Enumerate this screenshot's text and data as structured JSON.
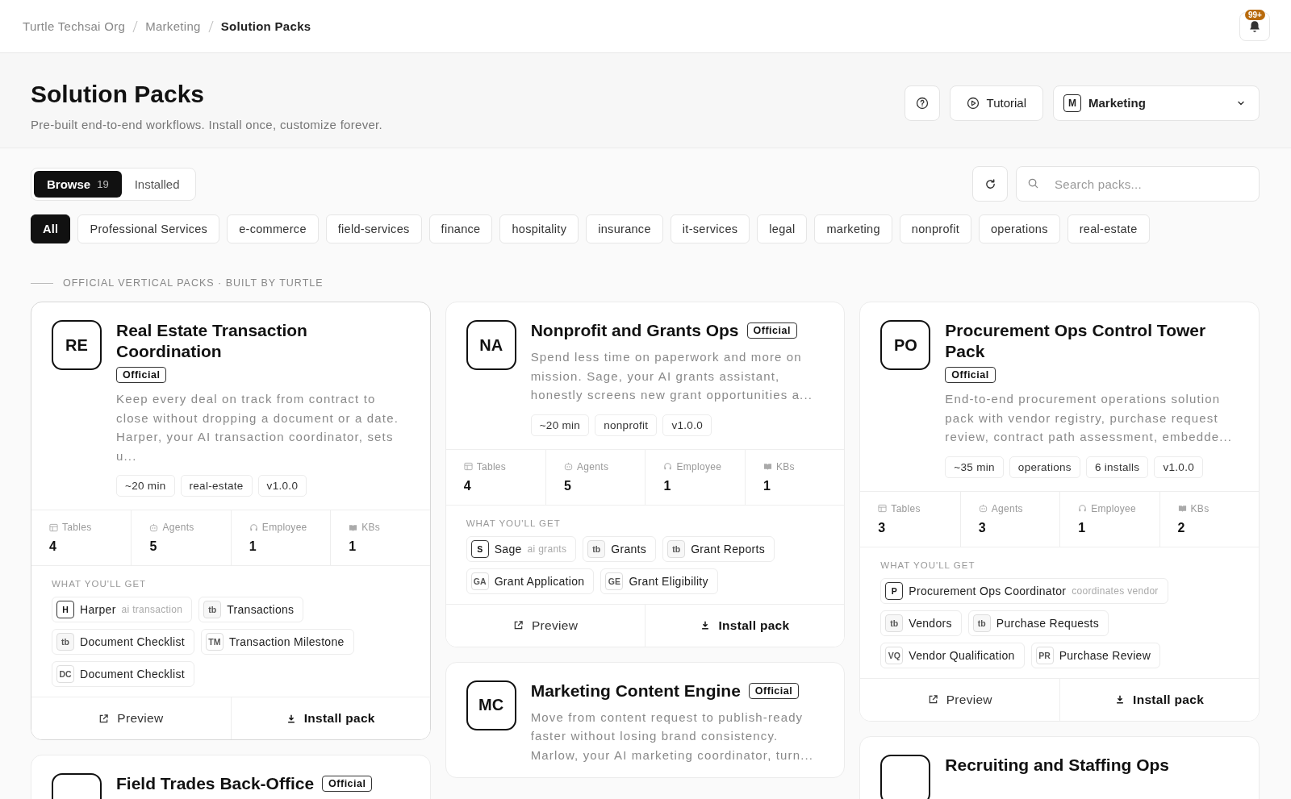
{
  "breadcrumb": [
    {
      "label": "Turtle Techsai Org",
      "current": false
    },
    {
      "label": "Marketing",
      "current": false
    },
    {
      "label": "Solution Packs",
      "current": true
    }
  ],
  "notifications": {
    "badge": "99+"
  },
  "header": {
    "title": "Solution Packs",
    "subtitle": "Pre-built end-to-end workflows. Install once, customize forever.",
    "tutorial": "Tutorial",
    "workspace": {
      "code": "M",
      "name": "Marketing"
    }
  },
  "view_tabs": [
    {
      "label": "Browse",
      "count": "19",
      "selected": true
    },
    {
      "label": "Installed",
      "selected": false
    }
  ],
  "search": {
    "placeholder": "Search packs..."
  },
  "filters": [
    {
      "label": "All",
      "selected": true
    },
    {
      "label": "Professional Services",
      "selected": false
    },
    {
      "label": "e-commerce",
      "selected": false
    },
    {
      "label": "field-services",
      "selected": false
    },
    {
      "label": "finance",
      "selected": false
    },
    {
      "label": "hospitality",
      "selected": false
    },
    {
      "label": "insurance",
      "selected": false
    },
    {
      "label": "it-services",
      "selected": false
    },
    {
      "label": "legal",
      "selected": false
    },
    {
      "label": "marketing",
      "selected": false
    },
    {
      "label": "nonprofit",
      "selected": false
    },
    {
      "label": "operations",
      "selected": false
    },
    {
      "label": "real-estate",
      "selected": false
    }
  ],
  "section_label": "OFFICIAL VERTICAL PACKS · BUILT BY TURTLE",
  "columns": [
    {
      "packs": [
        {
          "code": "RE",
          "title": "Real Estate Transaction Coordination",
          "badge": "Official",
          "description": "Keep every deal on track from contract to close without dropping a document or a date. Harper, your AI transaction coordinator, sets u...",
          "tags": [
            "~20 min",
            "real-estate",
            "v1.0.0"
          ],
          "stats": [
            {
              "kind": "tables",
              "label": "Tables",
              "value": "4"
            },
            {
              "kind": "agents",
              "label": "Agents",
              "value": "5"
            },
            {
              "kind": "employee",
              "label": "Employee",
              "value": "1"
            },
            {
              "kind": "kbs",
              "label": "KBs",
              "value": "1"
            }
          ],
          "includes_label": "WHAT YOU'LL GET",
          "includes": [
            {
              "kind": "agent",
              "code": "H",
              "name": "Harper",
              "note": "ai transaction"
            },
            {
              "kind": "table",
              "code": "tb",
              "name": "Transactions"
            },
            {
              "kind": "table",
              "code": "tb",
              "name": "Document Checklist"
            },
            {
              "kind": "workflow",
              "code": "TM",
              "name": "Transaction Milestone"
            },
            {
              "kind": "workflow",
              "code": "DC",
              "name": "Document Checklist"
            }
          ],
          "actions": [
            {
              "kind": "preview",
              "label": "Preview"
            },
            {
              "kind": "install",
              "label": "Install pack"
            }
          ]
        },
        {
          "title": "Field Trades Back-Office",
          "badge": "Official"
        }
      ]
    },
    {
      "packs": [
        {
          "code": "NA",
          "title": "Nonprofit and Grants Ops",
          "badge": "Official",
          "description": "Spend less time on paperwork and more on mission. Sage, your AI grants assistant, honestly screens new grant opportunities a...",
          "tags": [
            "~20 min",
            "nonprofit",
            "v1.0.0"
          ],
          "stats": [
            {
              "kind": "tables",
              "label": "Tables",
              "value": "4"
            },
            {
              "kind": "agents",
              "label": "Agents",
              "value": "5"
            },
            {
              "kind": "employee",
              "label": "Employee",
              "value": "1"
            },
            {
              "kind": "kbs",
              "label": "KBs",
              "value": "1"
            }
          ],
          "includes_label": "WHAT YOU'LL GET",
          "includes": [
            {
              "kind": "agent",
              "code": "S",
              "name": "Sage",
              "note": "ai grants"
            },
            {
              "kind": "table",
              "code": "tb",
              "name": "Grants"
            },
            {
              "kind": "table",
              "code": "tb",
              "name": "Grant Reports"
            },
            {
              "kind": "workflow",
              "code": "GA",
              "name": "Grant Application"
            },
            {
              "kind": "workflow",
              "code": "GE",
              "name": "Grant Eligibility"
            }
          ],
          "actions": [
            {
              "kind": "preview",
              "label": "Preview"
            },
            {
              "kind": "install",
              "label": "Install pack"
            }
          ]
        },
        {
          "code": "MC",
          "title": "Marketing Content Engine",
          "badge": "Official",
          "description": "Move from content request to publish-ready faster without losing brand consistency. Marlow, your AI marketing coordinator, turn..."
        }
      ]
    },
    {
      "packs": [
        {
          "code": "PO",
          "title": "Procurement Ops Control Tower Pack",
          "badge": "Official",
          "description": "End-to-end procurement operations solution pack with vendor registry, purchase request review, contract path assessment, embedde...",
          "tags": [
            "~35 min",
            "operations",
            "6 installs",
            "v1.0.0"
          ],
          "stats": [
            {
              "kind": "tables",
              "label": "Tables",
              "value": "3"
            },
            {
              "kind": "agents",
              "label": "Agents",
              "value": "3"
            },
            {
              "kind": "employee",
              "label": "Employee",
              "value": "1"
            },
            {
              "kind": "kbs",
              "label": "KBs",
              "value": "2"
            }
          ],
          "includes_label": "WHAT YOU'LL GET",
          "includes": [
            {
              "kind": "agent",
              "code": "P",
              "name": "Procurement Ops Coordinator",
              "note": "coordinates vendor"
            },
            {
              "kind": "table",
              "code": "tb",
              "name": "Vendors"
            },
            {
              "kind": "table",
              "code": "tb",
              "name": "Purchase Requests"
            },
            {
              "kind": "workflow",
              "code": "VQ",
              "name": "Vendor Qualification"
            },
            {
              "kind": "workflow",
              "code": "PR",
              "name": "Purchase Review"
            }
          ],
          "actions": [
            {
              "kind": "preview",
              "label": "Preview"
            },
            {
              "kind": "install",
              "label": "Install pack"
            }
          ]
        },
        {
          "title": "Recruiting and Staffing Ops"
        }
      ]
    }
  ]
}
